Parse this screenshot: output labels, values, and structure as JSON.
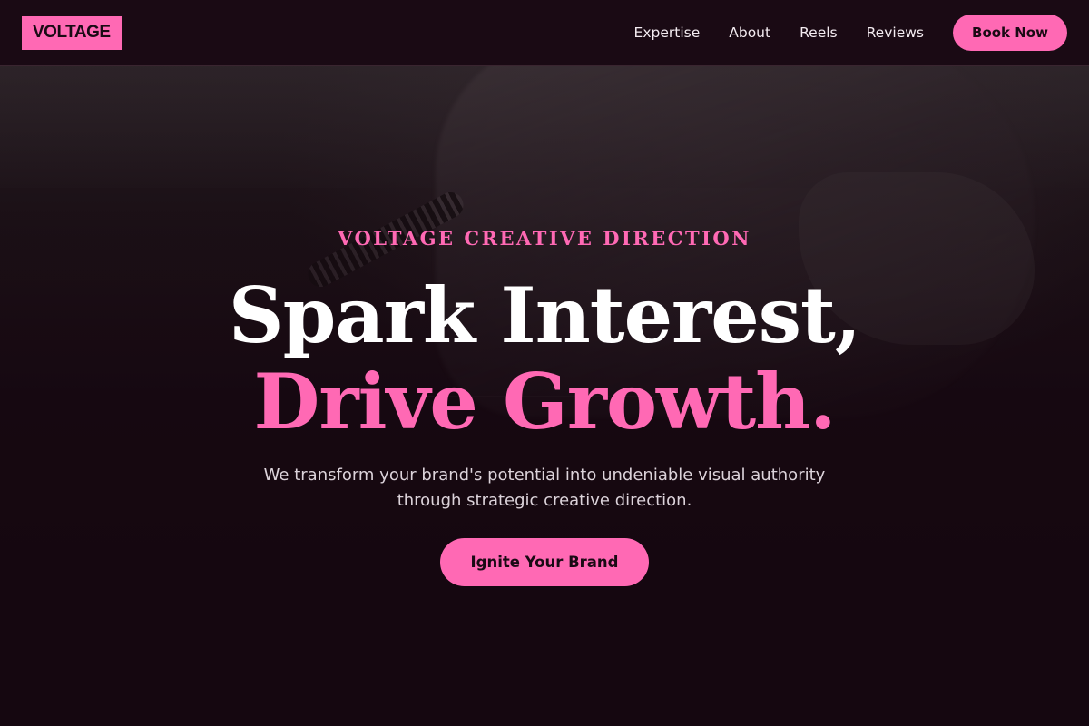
{
  "brand": {
    "logo_text": "VOLTAGE",
    "accent_color": "#ff69b4",
    "background_color": "#150710"
  },
  "nav": {
    "links": [
      "Expertise",
      "About",
      "Reels",
      "Reviews"
    ],
    "cta_label": "Book Now"
  },
  "hero": {
    "eyebrow": "VOLTAGE CREATIVE DIRECTION",
    "headline_line1": "Spark Interest,",
    "headline_line2": "Drive Growth.",
    "subtext": "We transform your brand's potential into undeniable visual authority through strategic creative direction.",
    "cta_label": "Ignite Your Brand",
    "background_image": "person in denim jacket holding camera strap (dark overlay)"
  }
}
